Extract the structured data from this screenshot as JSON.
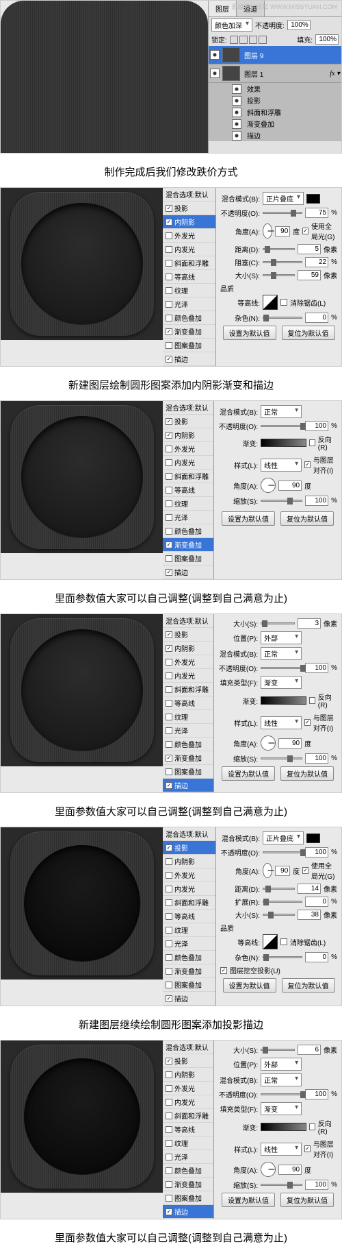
{
  "watermark": {
    "site": "思缘设计论坛",
    "url": "WWW.MISSYUAN.COM"
  },
  "layers_panel": {
    "tab_layers": "图层",
    "tab_channels": "通道",
    "blend_mode": "颜色加深",
    "opacity_label": "不透明度:",
    "opacity": "100%",
    "lock_label": "锁定:",
    "fill_label": "填充:",
    "fill": "100%",
    "layer9": "图层 9",
    "layer1": "图层 1",
    "fx_title": "效果",
    "fx": [
      "投影",
      "斜面和浮雕",
      "渐变叠加",
      "描边"
    ]
  },
  "styles": {
    "header": "混合选项:默认",
    "items": [
      "投影",
      "内阴影",
      "外发光",
      "内发光",
      "斜面和浮雕",
      "等高线",
      "纹理",
      "光泽",
      "颜色叠加",
      "渐变叠加",
      "图案叠加",
      "描边"
    ]
  },
  "cap1": "制作完成后我们修改跌价方式",
  "cap2": "新建图层绘制圆形图案添加内阴影渐变和描边",
  "cap3": "里面参数值大家可以自己调整(调整到自己满意为止)",
  "cap4": "里面参数值大家可以自己调整(调整到自己满意为止)",
  "cap5": "新建图层继续绘制圆形图案添加投影描边",
  "cap6": "里面参数值大家可以自己调整(调整到自己满意为止)",
  "common": {
    "blend_label": "混合模式(B):",
    "opacity_label": "不透明度(O):",
    "angle_label": "角度(A):",
    "use_global": "使用全局光(G)",
    "distance_label": "距离(D):",
    "choke_label": "阻塞(C):",
    "size_label": "大小(S):",
    "px": "像素",
    "pct": "%",
    "deg": "度",
    "quality": "品质",
    "contour_label": "等高线:",
    "anti_alias": "消除锯齿(L)",
    "noise_label": "杂色(N):",
    "set_default": "设置为默认值",
    "reset_default": "复位为默认值",
    "gradient_label": "渐变:",
    "reverse": "反向(R)",
    "style_label": "样式(L):",
    "linear": "线性",
    "align": "与图层对齐(I)",
    "scale_label": "缩放(S):",
    "position_label": "位置(P):",
    "outside": "外部",
    "normal": "正常",
    "multiply": "正片叠底",
    "fill_type_label": "填充类型(F):",
    "fill_gradient": "渐变",
    "spread_label": "扩展(R):",
    "knockout": "图层挖空投影(U)"
  },
  "p2": {
    "mode": "正片叠底",
    "opacity": "75",
    "angle": "90",
    "distance": "5",
    "choke": "22",
    "size": "59",
    "noise": "0"
  },
  "p3": {
    "mode": "正常",
    "opacity": "100",
    "style": "线性",
    "angle": "90",
    "scale": "100"
  },
  "p4": {
    "size": "3",
    "position": "外部",
    "mode": "正常",
    "opacity": "100",
    "style": "线性",
    "angle": "90",
    "scale": "100"
  },
  "p5": {
    "mode": "正片叠底",
    "opacity": "100",
    "angle": "90",
    "distance": "14",
    "spread": "0",
    "size": "38",
    "noise": "0"
  },
  "p6": {
    "size": "6",
    "position": "外部",
    "mode": "正常",
    "opacity": "100",
    "style": "线性",
    "angle": "90",
    "scale": "100"
  }
}
